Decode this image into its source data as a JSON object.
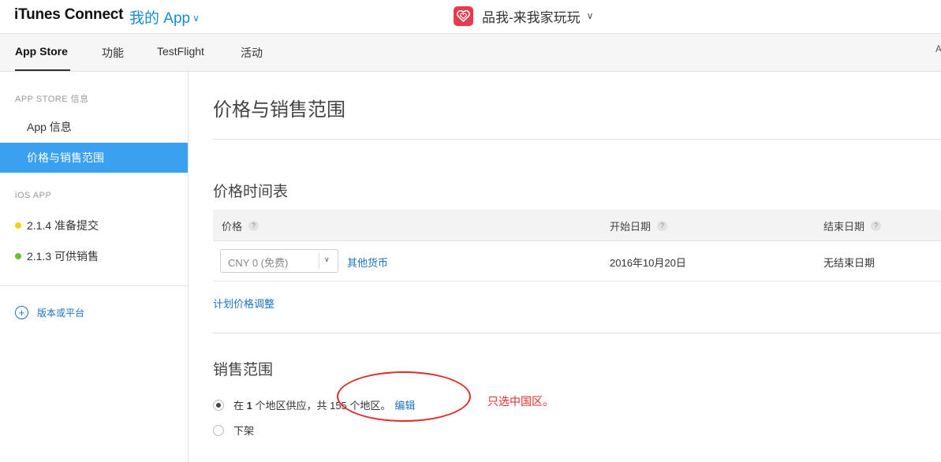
{
  "header": {
    "brand": "iTunes Connect",
    "my_app": "我的 App",
    "app_name": "品我-来我家玩玩"
  },
  "tabs": [
    {
      "label": "App Store",
      "active": true
    },
    {
      "label": "功能",
      "active": false
    },
    {
      "label": "TestFlight",
      "active": false
    },
    {
      "label": "活动",
      "active": false
    }
  ],
  "tabs_edge": "A",
  "sidebar": {
    "app_store_section": "APP STORE 信息",
    "items": [
      {
        "label": "App 信息",
        "active": false
      },
      {
        "label": "价格与销售范围",
        "active": true
      }
    ],
    "ios_section": "iOS APP",
    "versions": [
      {
        "label": "2.1.4 准备提交",
        "status_color": "#f0d21a"
      },
      {
        "label": "2.1.3 可供销售",
        "status_color": "#62c23a"
      }
    ],
    "add_label": "版本或平台"
  },
  "main": {
    "title": "价格与销售范围",
    "schedule_title": "价格时间表",
    "table": {
      "headers": [
        "价格",
        "开始日期",
        "结束日期"
      ],
      "help_icon_glyph": "?",
      "row": {
        "price": "CNY 0 (免费)",
        "other_currency": "其他货币",
        "start_date": "2016年10月20日",
        "end_date": "无结束日期"
      }
    },
    "plan_link": "计划价格调整",
    "availability_title": "销售范围",
    "availability_options": [
      {
        "prefix": "在 ",
        "count": "1",
        "suffix": " 个地区供应，共 155 个地区。",
        "edit": "编辑",
        "checked": true
      },
      {
        "label": "下架",
        "checked": false
      }
    ]
  },
  "annotation": {
    "text": "只选中国区。",
    "color": "#e12a2a"
  },
  "colors": {
    "accent": "#1a72c4",
    "sidebar_active": "#3aa0f0",
    "app_icon": "#e8394d"
  }
}
